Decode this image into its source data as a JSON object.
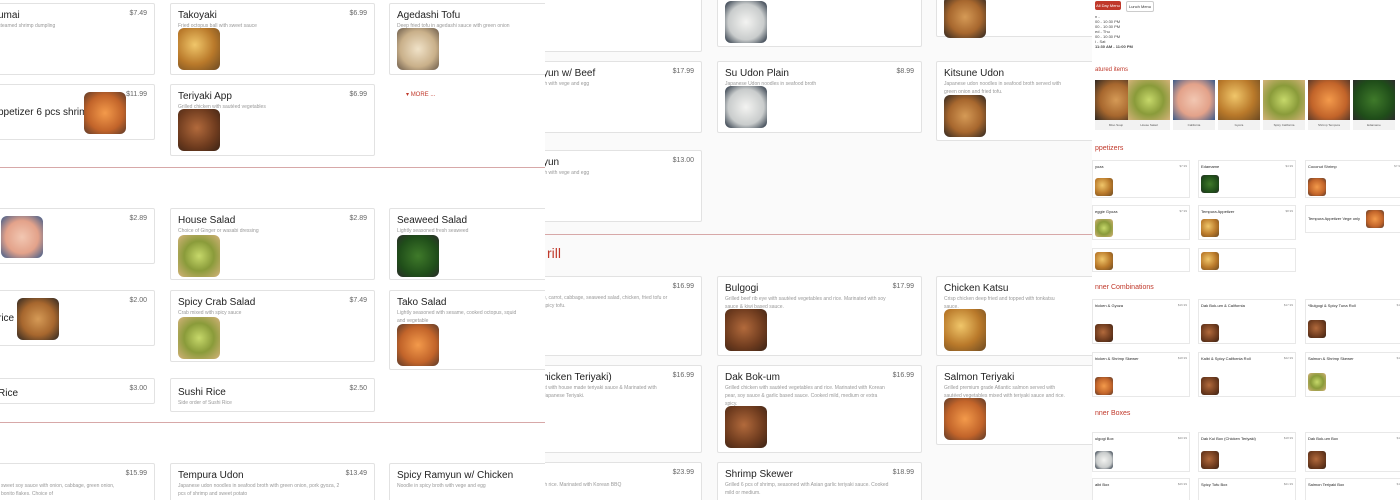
{
  "panel1": {
    "items": [
      {
        "name": "umai",
        "price": "$7.49",
        "desc": "steamed shrimp dumpling"
      },
      {
        "name": "Takoyaki",
        "price": "$6.99",
        "desc": "Fried octopus ball with sweet sauce"
      },
      {
        "name": "Agedashi Tofu",
        "price": "",
        "desc": "Deep fried tofu in agedashi sauce with green onion"
      },
      {
        "name": "ppetizer 6 pcs shrimp",
        "price": "$11.99",
        "desc": ""
      },
      {
        "name": "Teriyaki App",
        "price": "$6.99",
        "desc": "Grilled chicken with sautéed vegetables"
      },
      {
        "name": "",
        "price": "$2.89",
        "desc": ""
      },
      {
        "name": "House Salad",
        "price": "$2.89",
        "desc": "Choice of Ginger or wasabi dressing"
      },
      {
        "name": "Seaweed Salad",
        "price": "",
        "desc": "Lightly seasoned fresh seaweed"
      },
      {
        "name": "rice",
        "price": "$2.00",
        "desc": ""
      },
      {
        "name": "Spicy Crab Salad",
        "price": "$7.49",
        "desc": "Crab mixed with spicy sauce"
      },
      {
        "name": "Tako Salad",
        "price": "",
        "desc": "Lightly seasoned with sesame, cooked octopus, squid and vegetable"
      },
      {
        "name": "Rice",
        "price": "$3.00",
        "desc": ""
      },
      {
        "name": "Sushi Rice",
        "price": "$2.50",
        "desc": "Side order of Sushi Rice"
      },
      {
        "name": "",
        "price": "$15.99",
        "desc": "sweet soy sauce with onion, cabbage, green onion, bonito flakes. Choice of"
      },
      {
        "name": "Tempura Udon",
        "price": "$13.49",
        "desc": "Japanese udon noodles in seafood broth with green onion, pork gyoza, 2 pcs of shrimp and sweet potato"
      },
      {
        "name": "Spicy Ramyun w/ Chicken",
        "price": "",
        "desc": "Noodle in spicy broth with vege and egg"
      }
    ],
    "more": "MORE ..."
  },
  "panel2": {
    "section": "rill",
    "items": [
      {
        "name": "yun w/ Beef",
        "price": "$17.99",
        "desc": "th with vege and egg"
      },
      {
        "name": "Su Udon Plain",
        "price": "$8.99",
        "desc": "Japanese Udon noodles in seafood broth"
      },
      {
        "name": "Kitsune Udon",
        "price": "",
        "desc": "Japanese udon noodles in seafood broth served with green onion and fried tofu."
      },
      {
        "name": "yun",
        "price": "$13.00",
        "desc": "th with vege and egg"
      },
      {
        "name": "",
        "price": "$16.99",
        "desc": "e, carrot, cabbage, seaweed salad, chicken, fried tofu or spicy tofu."
      },
      {
        "name": "Bulgogi",
        "price": "$17.99",
        "desc": "Grilled beef rib eye with sautéed vegetables and rice. Marinated with soy sauce & kiwi based sauce."
      },
      {
        "name": "Chicken Katsu",
        "price": "",
        "desc": "Crisp chicken deep fried and topped with tonkatsu sauce."
      },
      {
        "name": "hicken Teriyaki)",
        "price": "$16.99",
        "desc": "st with house made teriyaki sauce & Marinated with Japanese Teriyaki."
      },
      {
        "name": "Dak Bok-um",
        "price": "$16.99",
        "desc": "Grilled chicken with sautéed vegetables and rice. Marinated with Korean pear, soy sauce & garlic based sauce. Cooked mild, medium or extra spicy."
      },
      {
        "name": "Salmon Teriyaki",
        "price": "",
        "desc": "Grilled premium grade Atlantic salmon served with sautéed vegetables mixed with teriyaki sauce and rice."
      },
      {
        "name": "",
        "price": "$23.99",
        "desc": "th rice. Marinated with Korean BBQ"
      },
      {
        "name": "Shrimp Skewer",
        "price": "$18.99",
        "desc": "Grilled 6 pcs of shrimp, seasoned with Asian garlic teriyaki sauce. Cooked mild or medium."
      }
    ]
  },
  "panel3": {
    "buttons": [
      "All Day Menu",
      "Lunch Menu"
    ],
    "hours": [
      "n -",
      "00 - 10:30 PM",
      "00 - 10:30 PM",
      "ed - Thu",
      "00 - 10:30 PM",
      "i - Sat",
      "11:30 AM - 11:00 PM"
    ],
    "featured_title": "atured items",
    "featured": [
      "Miso Soup",
      "House Salad",
      "California",
      "Gyoza",
      "Spicy California",
      "Shrimp Tempura",
      "Edamame"
    ],
    "appetizers_title": "ppetizers",
    "appetizers": [
      {
        "name": "yoza",
        "price": "$7.99"
      },
      {
        "name": "Edamame",
        "price": "$4.99"
      },
      {
        "name": "Coconut Shrimp",
        "price": "$7.9"
      },
      {
        "name": "eggie Gyoza",
        "price": "$7.99"
      },
      {
        "name": "Tempura Appetizer",
        "price": "$8.99"
      },
      {
        "name": "Tempura Appetizer Vege only",
        "price": ""
      }
    ],
    "dinner_combos_title": "nner Combinations",
    "dinner_combos": [
      {
        "name": "hicken & Gyoza",
        "price": "$16.99"
      },
      {
        "name": "Dak Bok-um & California",
        "price": "$17.99"
      },
      {
        "name": "*Bulgogi & Spicy Tuna Roll",
        "price": "$1"
      },
      {
        "name": "hicken & Shrimp Skewer",
        "price": "$18.99"
      },
      {
        "name": "Kalbi & Spicy California Roll",
        "price": "$22.99"
      },
      {
        "name": "Salmon & Shrimp Skewer",
        "price": "$1"
      }
    ],
    "dinner_boxes_title": "nner Boxes",
    "dinner_boxes": [
      {
        "name": "ulgogi Box",
        "price": "$20.99"
      },
      {
        "name": "Dak Kui Box (Chicken Teriyaki)",
        "price": "$18.99"
      },
      {
        "name": "Dak Bok-um Box",
        "price": "$1"
      },
      {
        "name": "albi Box",
        "price": "$26.99"
      },
      {
        "name": "Spicy Tofu Box",
        "price": "$21.99"
      },
      {
        "name": "Salmon Teriyaki Box",
        "price": "$1"
      }
    ]
  }
}
